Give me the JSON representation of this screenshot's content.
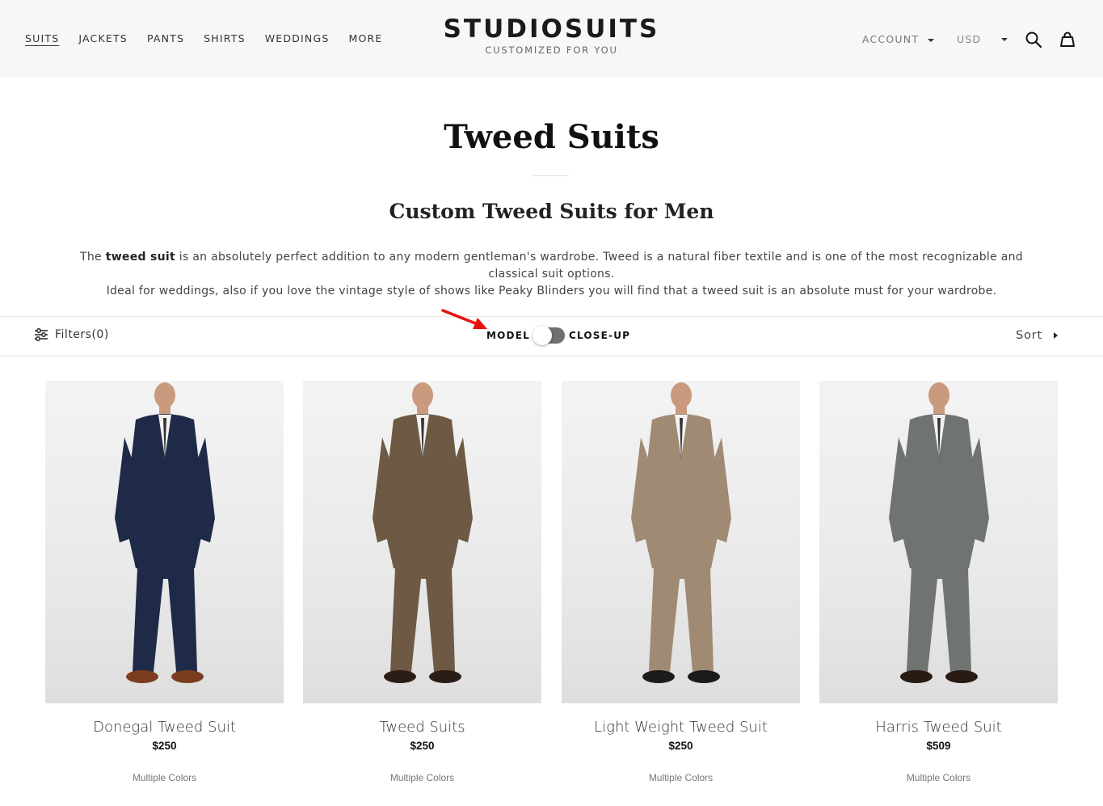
{
  "header": {
    "nav": [
      "SUITS",
      "JACKETS",
      "PANTS",
      "SHIRTS",
      "WEDDINGS",
      "MORE"
    ],
    "brand": "STUDIOSUITS",
    "tagline": "CUSTOMIZED FOR YOU",
    "account_label": "ACCOUNT",
    "currency_label": "USD"
  },
  "hero": {
    "title": "Tweed Suits",
    "subtitle": "Custom Tweed Suits for Men",
    "desc_lead": "The ",
    "desc_bold": "tweed suit",
    "desc_rest": " is an absolutely perfect addition to any modern gentleman's wardrobe. Tweed is a natural fiber textile and is one of the most recognizable and classical suit options.",
    "desc_line2": "Ideal for weddings, also if you love the vintage style of shows like Peaky Blinders you will find that a tweed suit is an absolute must for your wardrobe."
  },
  "toolbar": {
    "filters_label": "Filters(0)",
    "toggle_left": "MODEL",
    "toggle_right": "CLOSE-UP",
    "sort_label": "Sort"
  },
  "products": [
    {
      "name": "Donegal Tweed Suit",
      "price": "$250",
      "colors": "Multiple Colors",
      "suit_color": "#1f2a48",
      "shoe_color": "#7a3e1e"
    },
    {
      "name": "Tweed Suits",
      "price": "$250",
      "colors": "Multiple Colors",
      "suit_color": "#6e5a44",
      "shoe_color": "#2a1d18"
    },
    {
      "name": "Light Weight Tweed Suit",
      "price": "$250",
      "colors": "Multiple Colors",
      "suit_color": "#a08a74",
      "shoe_color": "#1b1b1b"
    },
    {
      "name": "Harris Tweed Suit",
      "price": "$509",
      "colors": "Multiple Colors",
      "suit_color": "#6f7470",
      "shoe_color": "#2a1a14"
    }
  ],
  "colors": {
    "header_bg": "#f7f7f7",
    "toggle_track": "#707070",
    "arrow": "#e81010"
  }
}
